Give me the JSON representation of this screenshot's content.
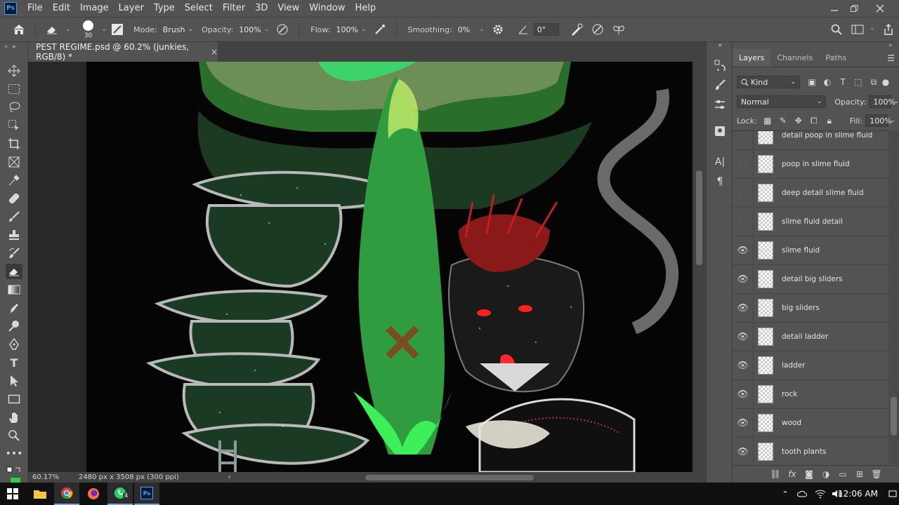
{
  "app": {
    "logo": "Ps"
  },
  "menu": [
    "File",
    "Edit",
    "Image",
    "Layer",
    "Type",
    "Select",
    "Filter",
    "3D",
    "View",
    "Window",
    "Help"
  ],
  "options": {
    "brush_size": "30",
    "mode_label": "Mode:",
    "mode_value": "Brush",
    "opacity_label": "Opacity:",
    "opacity_value": "100%",
    "flow_label": "Flow:",
    "flow_value": "100%",
    "smoothing_label": "Smoothing:",
    "smoothing_value": "0%",
    "angle_value": "0°"
  },
  "document": {
    "tab_title": "PEST REGIME.psd @ 60.2% (junkies, RGB/8) *",
    "close": "×"
  },
  "status": {
    "zoom": "60.17%",
    "info": "2480 px x 3508 px (300 ppi)",
    "chev": "›"
  },
  "layers_panel": {
    "tabs": [
      "Layers",
      "Channels",
      "Paths"
    ],
    "kind_label": "Kind",
    "blend_mode": "Normal",
    "opacity_label": "Opacity:",
    "opacity_value": "100%",
    "lock_label": "Lock:",
    "fill_label": "Fill:",
    "fill_value": "100%",
    "layers": [
      {
        "name": "detail poop in slime fluid",
        "visible": false
      },
      {
        "name": "poop in slime fluid",
        "visible": false
      },
      {
        "name": "deep detail slime fluid",
        "visible": false
      },
      {
        "name": "slime fluid detail",
        "visible": false
      },
      {
        "name": "slime fluid",
        "visible": true
      },
      {
        "name": "detail big sliders",
        "visible": true
      },
      {
        "name": "big sliders",
        "visible": true
      },
      {
        "name": "detail ladder",
        "visible": true
      },
      {
        "name": "ladder",
        "visible": true
      },
      {
        "name": "rock",
        "visible": true
      },
      {
        "name": "wood",
        "visible": true
      },
      {
        "name": "tooth plants",
        "visible": true
      }
    ]
  },
  "taskbar": {
    "clock": "12:06 AM",
    "whatsapp_badge": "4"
  },
  "colors": {
    "panel": "#535353",
    "dark": "#424242",
    "accent": "#31a8ff",
    "slime": "#2fd14a"
  }
}
